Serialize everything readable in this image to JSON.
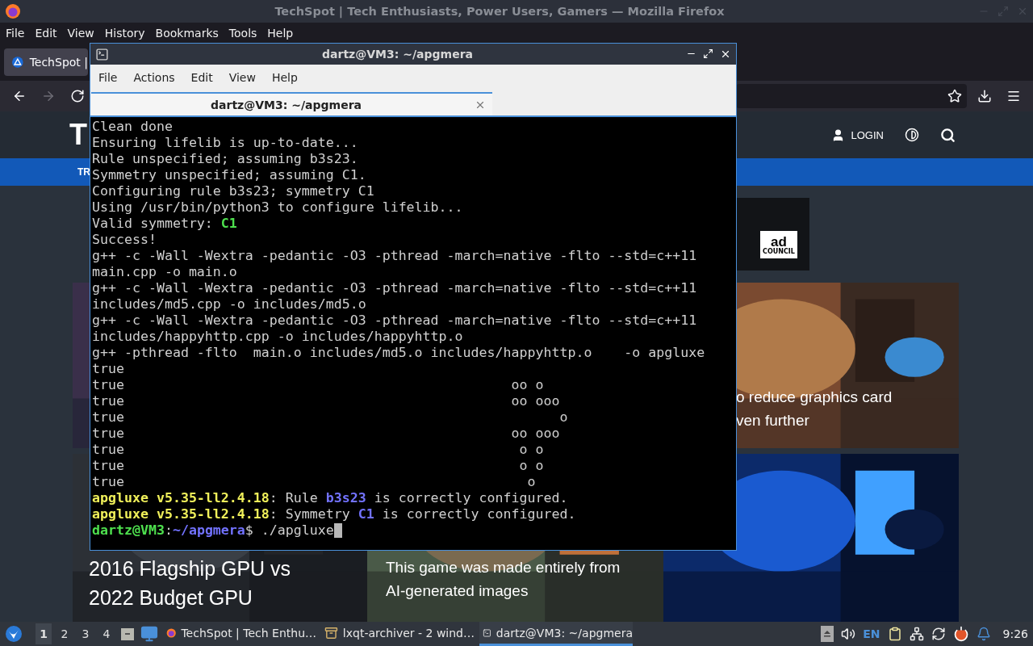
{
  "firefox": {
    "title": "TechSpot | Tech Enthusiasts, Power Users, Gamers — Mozilla Firefox",
    "menu": [
      "File",
      "Edit",
      "View",
      "History",
      "Bookmarks",
      "Tools",
      "Help"
    ],
    "tab": {
      "title": "TechSpot |",
      "selected": true
    },
    "nav_buttons": [
      {
        "kind": "back",
        "disabled": false
      },
      {
        "kind": "forward",
        "disabled": true
      },
      {
        "kind": "reload",
        "disabled": false
      }
    ]
  },
  "site": {
    "logo": "T",
    "login": "LOGIN",
    "nav_item": "TR",
    "ad_logo": {
      "main": "ad",
      "sub": "COUNCIL"
    },
    "top_story": {
      "lines": [
        "o reduce graphics card",
        "ven further"
      ]
    },
    "stories": [
      {
        "lines": [
          "2016 Flagship GPU vs",
          "2022 Budget GPU"
        ],
        "kind": "large"
      },
      {
        "lines": [
          "This game was made entirely from",
          "AI-generated images"
        ],
        "kind": "small"
      },
      {
        "kind": "picture"
      }
    ]
  },
  "terminal": {
    "title": "dartz@VM3: ~/apgmera",
    "menu": [
      "File",
      "Actions",
      "Edit",
      "View",
      "Help"
    ],
    "tab": {
      "title": "dartz@VM3: ~/apgmera",
      "selected": true
    },
    "lines": [
      {
        "segments": [
          {
            "text": "Clean done",
            "kind": "plain"
          }
        ]
      },
      {
        "segments": [
          {
            "text": "Ensuring lifelib is up-to-date...",
            "kind": "plain"
          }
        ]
      },
      {
        "segments": [
          {
            "text": "Rule unspecified; assuming b3s23.",
            "kind": "plain"
          }
        ]
      },
      {
        "segments": [
          {
            "text": "Symmetry unspecified; assuming C1.",
            "kind": "plain"
          }
        ]
      },
      {
        "segments": [
          {
            "text": "Configuring rule b3s23; symmetry C1",
            "kind": "plain"
          }
        ]
      },
      {
        "segments": [
          {
            "text": "Using /usr/bin/python3 to configure lifelib...",
            "kind": "plain"
          }
        ]
      },
      {
        "segments": [
          {
            "text": "Valid symmetry: ",
            "kind": "plain"
          },
          {
            "text": "C1",
            "kind": "green"
          }
        ]
      },
      {
        "segments": [
          {
            "text": "Success!",
            "kind": "plain"
          }
        ]
      },
      {
        "segments": [
          {
            "text": "g++ -c -Wall -Wextra -pedantic -O3 -pthread -march=native -flto --std=c++11",
            "kind": "plain"
          }
        ]
      },
      {
        "segments": [
          {
            "text": "main.cpp -o main.o",
            "kind": "plain"
          }
        ]
      },
      {
        "segments": [
          {
            "text": "g++ -c -Wall -Wextra -pedantic -O3 -pthread -march=native -flto --std=c++11",
            "kind": "plain"
          }
        ]
      },
      {
        "segments": [
          {
            "text": "includes/md5.cpp -o includes/md5.o",
            "kind": "plain"
          }
        ]
      },
      {
        "segments": [
          {
            "text": "g++ -c -Wall -Wextra -pedantic -O3 -pthread -march=native -flto --std=c++11",
            "kind": "plain"
          }
        ]
      },
      {
        "segments": [
          {
            "text": "includes/happyhttp.cpp -o includes/happyhttp.o",
            "kind": "plain"
          }
        ]
      },
      {
        "segments": [
          {
            "text": "g++ -pthread -flto  main.o includes/md5.o includes/happyhttp.o    -o apgluxe",
            "kind": "plain"
          }
        ]
      },
      {
        "segments": [
          {
            "text": "true",
            "kind": "plain"
          }
        ]
      },
      {
        "segments": [
          {
            "text": "true                                                oo o",
            "kind": "plain"
          }
        ]
      },
      {
        "segments": [
          {
            "text": "true                                                oo ooo",
            "kind": "plain"
          }
        ]
      },
      {
        "segments": [
          {
            "text": "true                                                      o",
            "kind": "plain"
          }
        ]
      },
      {
        "segments": [
          {
            "text": "true                                                oo ooo",
            "kind": "plain"
          }
        ]
      },
      {
        "segments": [
          {
            "text": "true                                                 o o",
            "kind": "plain"
          }
        ]
      },
      {
        "segments": [
          {
            "text": "true                                                 o o",
            "kind": "plain"
          }
        ]
      },
      {
        "segments": [
          {
            "text": "true                                                  o",
            "kind": "plain"
          }
        ]
      },
      {
        "segments": [
          {
            "text": "apgluxe v5.35-ll2.4.18",
            "kind": "yellow"
          },
          {
            "text": ": Rule ",
            "kind": "plain"
          },
          {
            "text": "b3s23",
            "kind": "blue"
          },
          {
            "text": " is correctly configured.",
            "kind": "plain"
          }
        ]
      },
      {
        "segments": [
          {
            "text": "apgluxe v5.35-ll2.4.18",
            "kind": "yellow"
          },
          {
            "text": ": Symmetry ",
            "kind": "plain"
          },
          {
            "text": "C1",
            "kind": "blue"
          },
          {
            "text": " is correctly configured.",
            "kind": "plain"
          }
        ]
      },
      {
        "segments": [
          {
            "text": "dartz@VM3",
            "kind": "green"
          },
          {
            "text": ":",
            "kind": "plain"
          },
          {
            "text": "~/apgmera",
            "kind": "blue"
          },
          {
            "text": "$ ./apgluxe",
            "kind": "plain"
          }
        ],
        "cursor": true
      }
    ]
  },
  "taskbar": {
    "workspaces": [
      {
        "label": "1",
        "selected": true
      },
      {
        "label": "2",
        "selected": false
      },
      {
        "label": "3",
        "selected": false
      },
      {
        "label": "4",
        "selected": false
      }
    ],
    "tasks": [
      {
        "label": "TechSpot | Tech Enthu…",
        "kind": "browser",
        "selected": false
      },
      {
        "label": "lxqt-archiver - 2 wind…",
        "kind": "archive",
        "selected": false
      },
      {
        "label": "dartz@VM3: ~/apgmera",
        "kind": "terminal",
        "selected": true
      }
    ],
    "language": "EN",
    "clock": "9:26"
  }
}
